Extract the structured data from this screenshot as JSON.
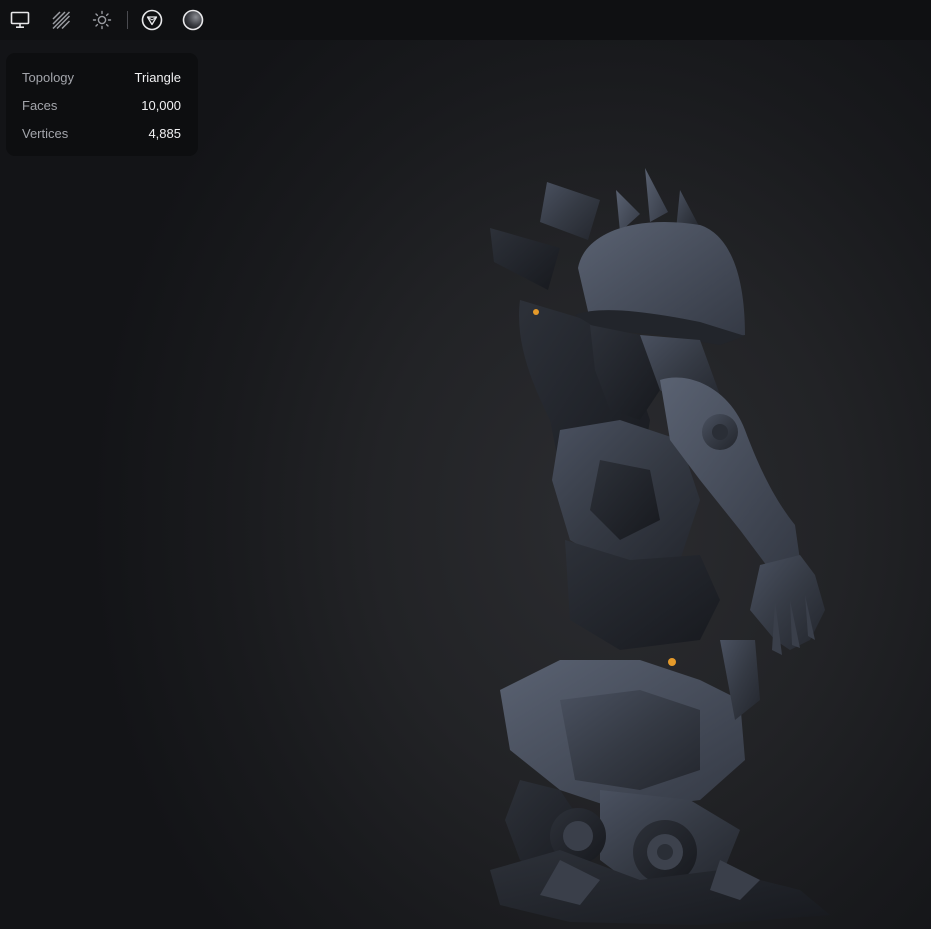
{
  "toolbar": {
    "buttons": [
      {
        "icon": "monitor-icon"
      },
      {
        "icon": "wireframe-icon"
      },
      {
        "icon": "sun-icon"
      },
      {
        "icon": "shield-sphere-icon"
      },
      {
        "icon": "sphere-icon"
      }
    ]
  },
  "stats": {
    "topology_label": "Topology",
    "topology_value": "Triangle",
    "faces_label": "Faces",
    "faces_value": "10,000",
    "vertices_label": "Vertices",
    "vertices_value": "4,885"
  },
  "colors": {
    "toolbar_bg": "#0f1012",
    "panel_bg": "#0d0e10",
    "viewport_bg": "#222326",
    "model_base": "#3a3f4a",
    "model_glow": "#e59a2a"
  }
}
